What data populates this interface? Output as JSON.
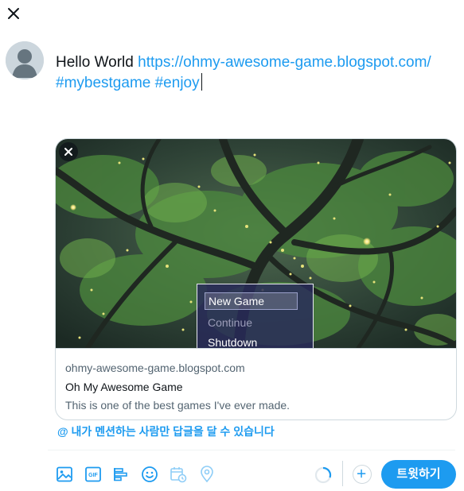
{
  "compose": {
    "text_plain": "Hello World ",
    "text_link": "https://ohmy-awesome-game.blogspot.com/ #mybestgame #enjoy"
  },
  "card": {
    "domain": "ohmy-awesome-game.blogspot.com",
    "title": "Oh My Awesome Game",
    "description": "This is one of the best games I've ever made.",
    "menu": {
      "items": [
        "New Game",
        "Continue",
        "Shutdown"
      ]
    }
  },
  "reply_setting": "@ 내가 멘션하는 사람만 답글을 달 수 있습니다",
  "tweet_button": "트윗하기",
  "icons": [
    "close-icon",
    "image-icon",
    "gif-icon",
    "poll-icon",
    "emoji-icon",
    "schedule-icon",
    "location-icon",
    "progress-circle-icon",
    "plus-icon"
  ],
  "colors": {
    "accent": "#1d9bf0",
    "text": "#0f1419",
    "muted": "#536471",
    "border": "#cfd9de"
  }
}
